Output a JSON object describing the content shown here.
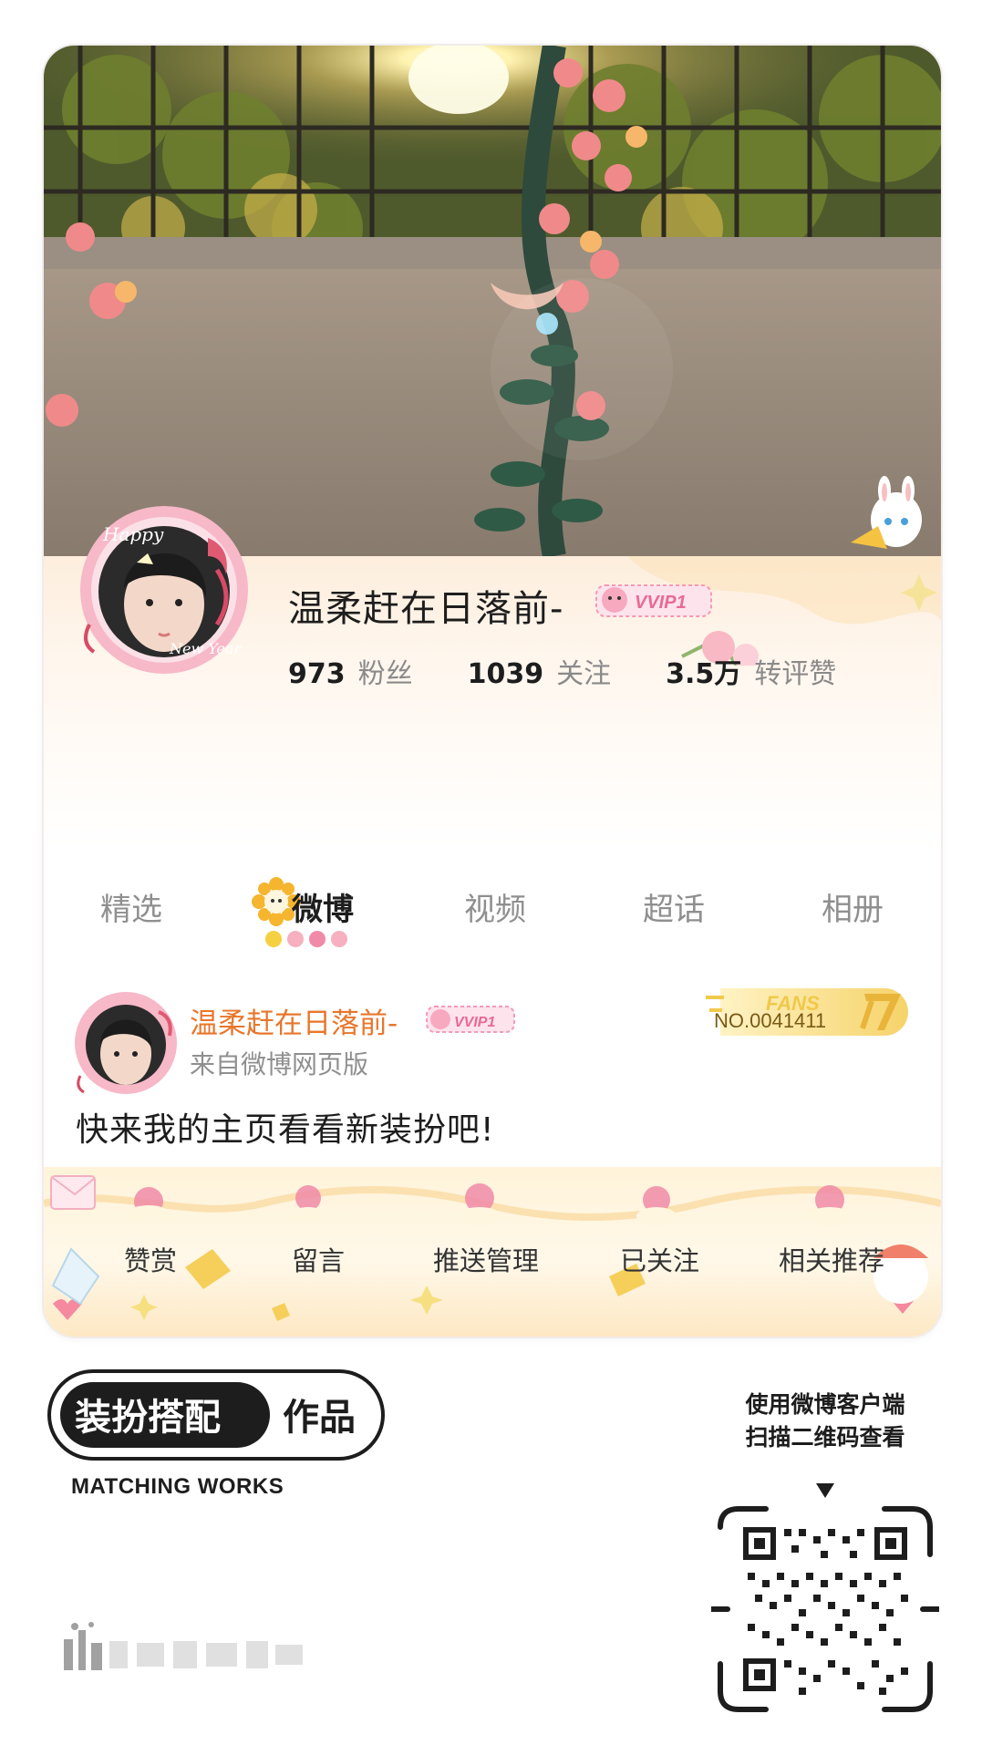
{
  "profile": {
    "username": "温柔赶在日落前-",
    "vip_badge": "VVIP1",
    "avatar_text_top": "Happy",
    "avatar_text_bottom": "New Year",
    "stats": [
      {
        "num": "973",
        "label": "粉丝"
      },
      {
        "num": "1039",
        "label": "关注"
      },
      {
        "num": "3.5万",
        "label": "转评赞"
      }
    ]
  },
  "tabs": [
    {
      "label": "精选",
      "active": false
    },
    {
      "label": "微博",
      "active": true
    },
    {
      "label": "视频",
      "active": false
    },
    {
      "label": "超话",
      "active": false
    },
    {
      "label": "相册",
      "active": false
    }
  ],
  "post": {
    "username": "温柔赶在日落前-",
    "vip_badge": "VVIP1",
    "source": "来自微博网页版",
    "fans_label": "FANS",
    "fans_no": "NO.0041411",
    "text": "快来我的主页看看新装扮吧!"
  },
  "actions": [
    {
      "label": "赞赏"
    },
    {
      "label": "留言"
    },
    {
      "label": "推送管理"
    },
    {
      "label": "已关注"
    },
    {
      "label": "相关推荐"
    }
  ],
  "footer": {
    "works_badge": "装扮搭配",
    "works_suffix": "作品",
    "subtitle": "MATCHING WORKS",
    "scan_line1": "使用微博客户端",
    "scan_line2": "扫描二维码查看"
  },
  "colors": {
    "accent_orange": "#e8762b",
    "pink": "#f4a3b5",
    "cream": "#fff3d9",
    "gold": "#f3c85a"
  }
}
